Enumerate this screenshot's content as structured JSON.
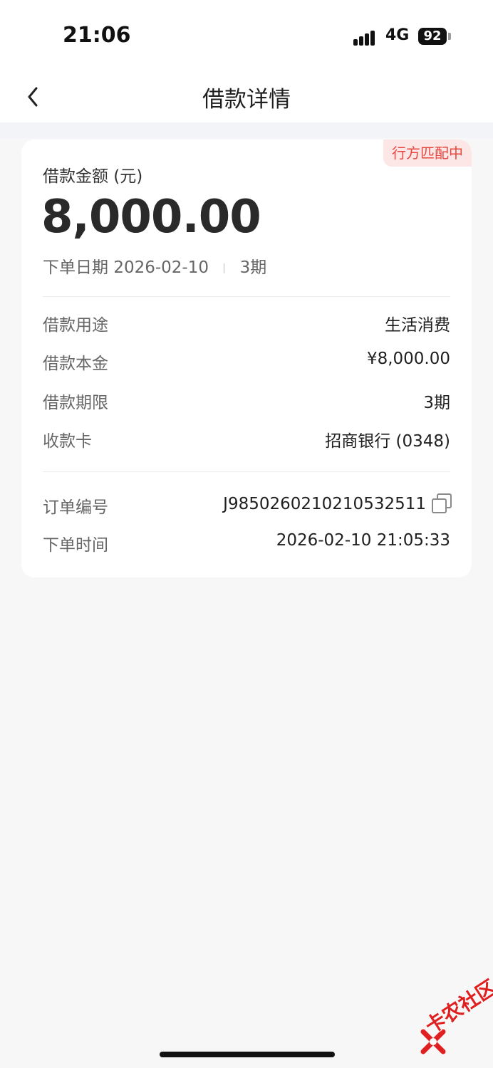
{
  "status_bar": {
    "time": "21:06",
    "network": "4G",
    "battery": "92"
  },
  "nav": {
    "title": "借款详情",
    "back_icon": "chevron-left-icon"
  },
  "card": {
    "status_tag": "行方匹配中",
    "amount_label": "借款金额 (元)",
    "amount": "8,000.00",
    "order_date_label": "下单日期",
    "order_date": "2026-02-10",
    "periods": "3期",
    "details": [
      {
        "label": "借款用途",
        "value": "生活消费"
      },
      {
        "label": "借款本金",
        "value": "¥8,000.00"
      },
      {
        "label": "借款期限",
        "value": "3期"
      },
      {
        "label": "收款卡",
        "value": "招商银行 (0348)"
      }
    ],
    "order": {
      "number_label": "订单编号",
      "number": "J9850260210210532511",
      "time_label": "下单时间",
      "time": "2026-02-10 21:05:33"
    }
  },
  "watermark": {
    "text": "卡农社区"
  },
  "colors": {
    "tag_bg": "#fde6e6",
    "tag_text": "#e5473f",
    "background": "#f7f7f8"
  }
}
